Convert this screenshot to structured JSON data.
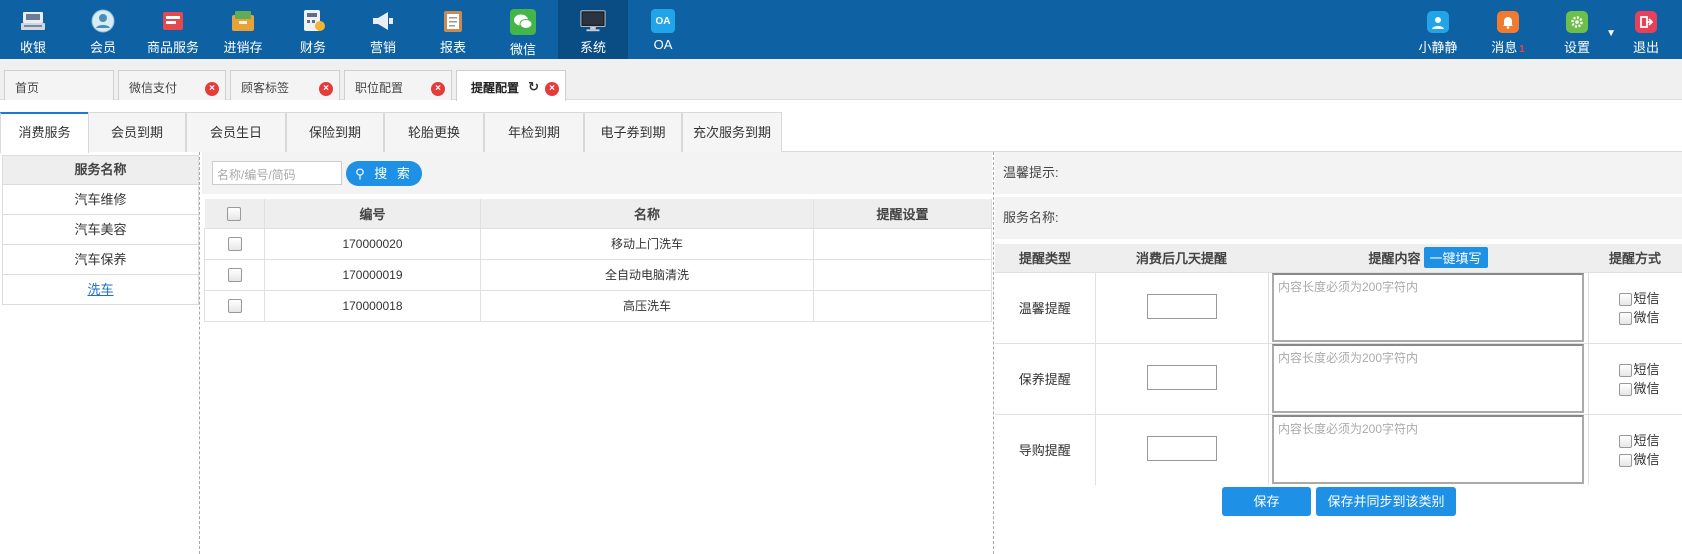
{
  "topnav": {
    "items": [
      {
        "label": "收银",
        "icon": "cashier-icon"
      },
      {
        "label": "会员",
        "icon": "member-icon"
      },
      {
        "label": "商品服务",
        "icon": "goods-service-icon"
      },
      {
        "label": "进销存",
        "icon": "inventory-icon"
      },
      {
        "label": "财务",
        "icon": "finance-icon"
      },
      {
        "label": "营销",
        "icon": "marketing-icon"
      },
      {
        "label": "报表",
        "icon": "report-icon"
      },
      {
        "label": "微信",
        "icon": "wechat-icon"
      },
      {
        "label": "系统",
        "icon": "system-icon"
      },
      {
        "label": "OA",
        "icon": "oa-icon",
        "icon_text": "OA"
      }
    ],
    "active": "系统",
    "right": {
      "user": "小静静",
      "messages": "消息",
      "message_count": "1",
      "settings": "设置",
      "logout": "退出"
    }
  },
  "page_tabs": [
    {
      "label": "首页",
      "closable": false
    },
    {
      "label": "微信支付",
      "closable": true
    },
    {
      "label": "顾客标签",
      "closable": true
    },
    {
      "label": "职位配置",
      "closable": true
    },
    {
      "label": "提醒配置",
      "closable": true,
      "active": true
    }
  ],
  "sub_tabs": [
    "消费服务",
    "会员到期",
    "会员生日",
    "保险到期",
    "轮胎更换",
    "年检到期",
    "电子券到期",
    "充次服务到期"
  ],
  "service_list": {
    "header": "服务名称",
    "items": [
      "汽车维修",
      "汽车美容",
      "汽车保养",
      "洗车"
    ],
    "selected": "洗车"
  },
  "search": {
    "placeholder": "名称/编号/简码",
    "button": "搜 索"
  },
  "table": {
    "columns": [
      "编号",
      "名称",
      "提醒设置"
    ],
    "rows": [
      {
        "code": "170000020",
        "name": "移动上门洗车",
        "setting": ""
      },
      {
        "code": "170000019",
        "name": "全自动电脑清洗",
        "setting": ""
      },
      {
        "code": "170000018",
        "name": "高压洗车",
        "setting": ""
      }
    ]
  },
  "right_panel": {
    "tip_label": "温馨提示:",
    "service_label": "服务名称:",
    "columns": [
      "提醒类型",
      "消费后几天提醒",
      "提醒内容",
      "提醒方式"
    ],
    "fill_button": "一键填写",
    "rows": [
      {
        "type": "温馨提醒",
        "placeholder": "内容长度必须为200字符内"
      },
      {
        "type": "保养提醒",
        "placeholder": "内容长度必须为200字符内"
      },
      {
        "type": "导购提醒",
        "placeholder": "内容长度必须为200字符内"
      }
    ],
    "methods": [
      "短信",
      "微信"
    ],
    "save": "保存",
    "save_sync": "保存并同步到该类别"
  },
  "colors": {
    "topbar": "#0e62a4",
    "accent": "#1e90e6",
    "close": "#e43b3b"
  }
}
